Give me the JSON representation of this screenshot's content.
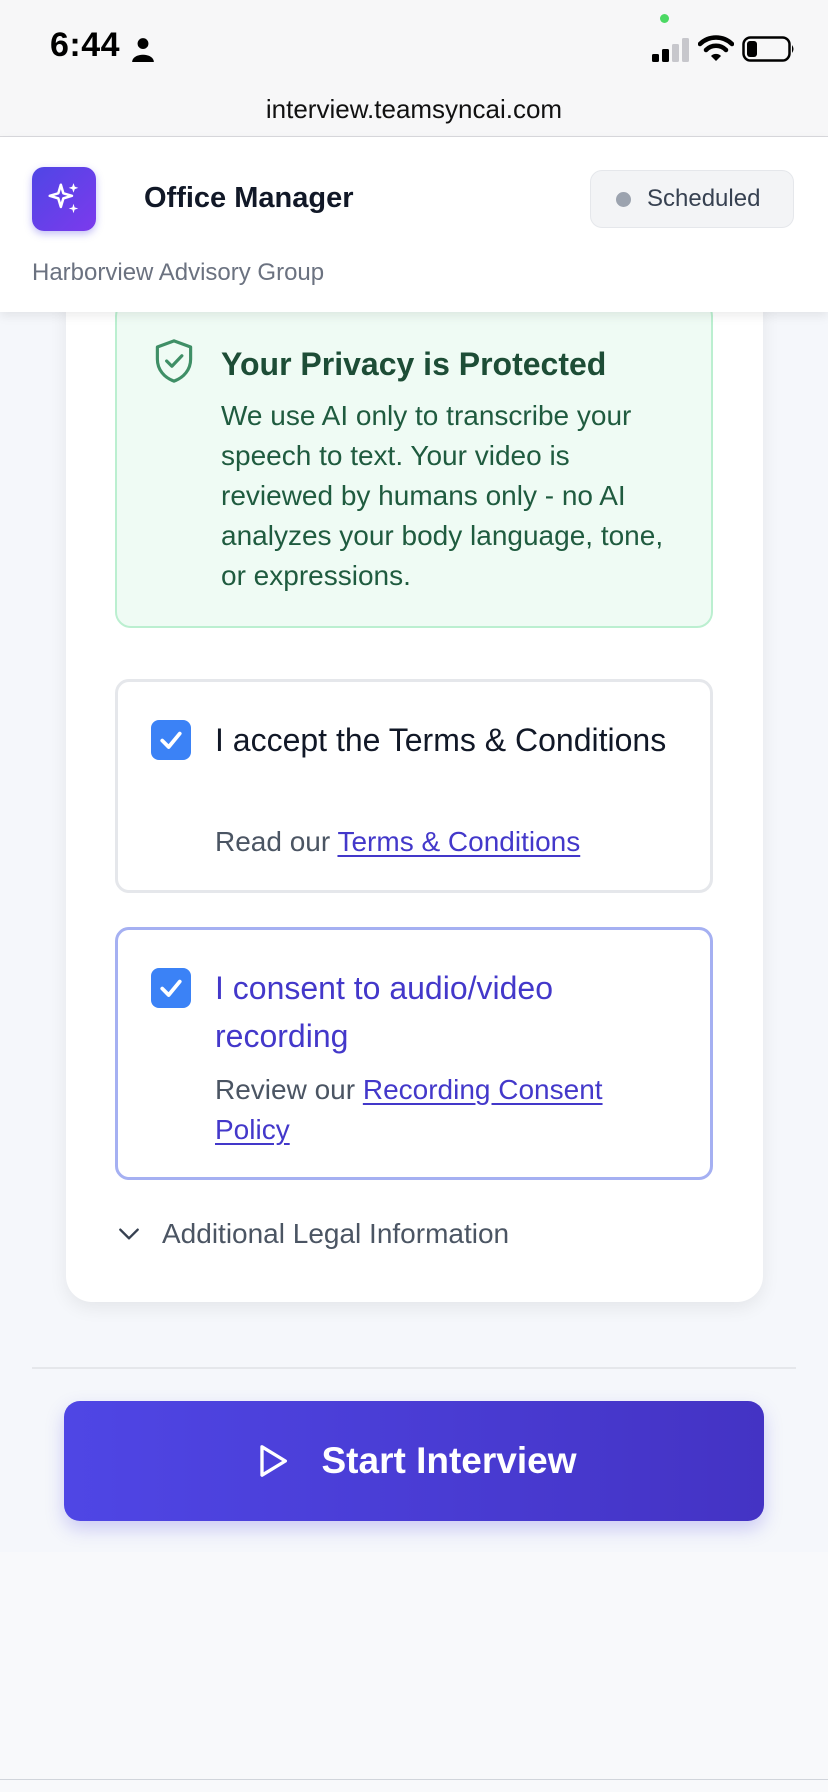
{
  "status_bar": {
    "time": "6:44",
    "icons": [
      "person-icon",
      "signal-icon",
      "wifi-icon",
      "battery-icon"
    ]
  },
  "browser": {
    "url": "interview.teamsyncai.com"
  },
  "header": {
    "logo_icon": "sparkles-icon",
    "job_title": "Office Manager",
    "company": "Harborview Advisory Group",
    "status": "Scheduled"
  },
  "privacy": {
    "icon": "shield-check-icon",
    "title": "Your Privacy is Protected",
    "text": "We use AI only to transcribe your speech to text. Your video is reviewed by humans only - no AI analyzes your body language, tone, or expressions."
  },
  "terms": {
    "checked": true,
    "label": "I accept the Terms & Conditions",
    "sub_prefix": "Read our ",
    "link": "Terms & Conditions"
  },
  "recording": {
    "checked": true,
    "label": "I consent to audio/video recording",
    "sub_prefix": "Review our ",
    "link": "Recording Consent Policy"
  },
  "legal": {
    "label": "Additional Legal Information"
  },
  "start_button": {
    "label": "Start Interview",
    "icon": "play-icon"
  },
  "colors": {
    "accent": "#4f46e5",
    "privacy_bg": "#effbf4",
    "checkbox": "#3b82f6"
  }
}
